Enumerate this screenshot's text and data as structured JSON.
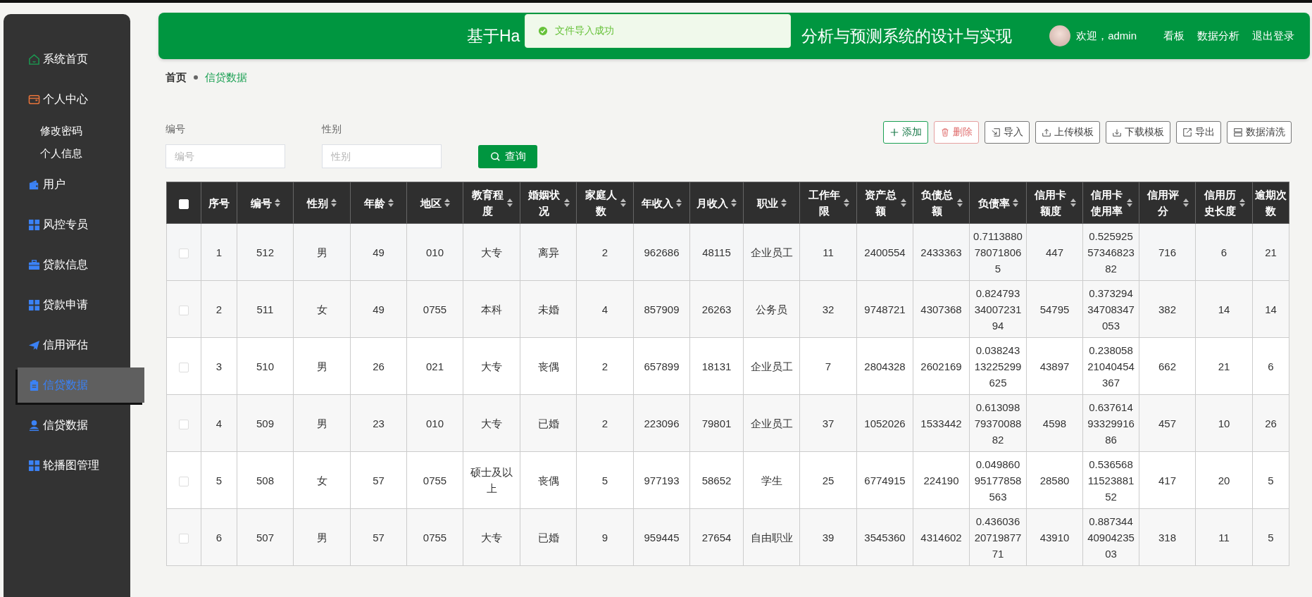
{
  "sidebar": {
    "items": [
      {
        "label": "系统首页",
        "selected": false
      },
      {
        "label": "个人中心",
        "selected": false,
        "children": [
          {
            "label": "修改密码",
            "selected": false
          },
          {
            "label": "个人信息",
            "selected": false
          }
        ]
      },
      {
        "label": "用户",
        "selected": false
      },
      {
        "label": "风控专员",
        "selected": false
      },
      {
        "label": "贷款信息",
        "selected": false
      },
      {
        "label": "贷款申请",
        "selected": false
      },
      {
        "label": "信用评估",
        "selected": false
      },
      {
        "label": "信贷数据",
        "selected": true
      },
      {
        "label": "信贷数据",
        "selected": false
      },
      {
        "label": "轮播图管理",
        "selected": false
      }
    ]
  },
  "header": {
    "title_start": "基于Ha",
    "title_end": "分析与预测系统的设计与实现",
    "welcome": "欢迎，admin",
    "links": [
      "看板",
      "数据分析",
      "退出登录"
    ]
  },
  "toast": {
    "message": "文件导入成功"
  },
  "breadcrumb": [
    "首页",
    "信贷数据"
  ],
  "search": {
    "fields": [
      {
        "label": "编号",
        "placeholder": "编号"
      },
      {
        "label": "性别",
        "placeholder": "性别"
      }
    ],
    "button": "查询"
  },
  "toolbar": [
    {
      "label": "添加",
      "kind": "add"
    },
    {
      "label": "删除",
      "kind": "delete"
    },
    {
      "label": "导入",
      "kind": "default"
    },
    {
      "label": "上传模板",
      "kind": "default"
    },
    {
      "label": "下载模板",
      "kind": "default"
    },
    {
      "label": "导出",
      "kind": "default"
    },
    {
      "label": "数据清洗",
      "kind": "default"
    }
  ],
  "table": {
    "select_all": false,
    "columns": [
      {
        "label": "序号",
        "sortable": false
      },
      {
        "label": "编号",
        "sortable": true
      },
      {
        "label": "性别",
        "sortable": true
      },
      {
        "label": "年龄",
        "sortable": true
      },
      {
        "label": "地区",
        "sortable": true
      },
      {
        "label": "教育程度",
        "sortable": true
      },
      {
        "label": "婚姻状况",
        "sortable": true
      },
      {
        "label": "家庭人数",
        "sortable": true
      },
      {
        "label": "年收入",
        "sortable": true
      },
      {
        "label": "月收入",
        "sortable": true
      },
      {
        "label": "职业",
        "sortable": true
      },
      {
        "label": "工作年限",
        "sortable": true
      },
      {
        "label": "资产总额",
        "sortable": true
      },
      {
        "label": "负债总额",
        "sortable": true
      },
      {
        "label": "负债率",
        "sortable": true
      },
      {
        "label": "信用卡额度",
        "sortable": true
      },
      {
        "label": "信用卡使用率",
        "sortable": true
      },
      {
        "label": "信用评分",
        "sortable": true
      },
      {
        "label": "信用历史长度",
        "sortable": true
      },
      {
        "label": "逾期次数",
        "sortable": false
      }
    ],
    "rows": [
      {
        "checked": false,
        "cells": [
          "1",
          "512",
          "男",
          "49",
          "010",
          "大专",
          "离异",
          "2",
          "962686",
          "48115",
          "企业员工",
          "11",
          "2400554",
          "2433363",
          "0.7113880780718065",
          "447",
          "0.5259255734682382",
          "716",
          "6",
          "21"
        ]
      },
      {
        "checked": false,
        "cells": [
          "2",
          "511",
          "女",
          "49",
          "0755",
          "本科",
          "未婚",
          "4",
          "857909",
          "26263",
          "公务员",
          "32",
          "9748721",
          "4307368",
          "0.8247933400723194",
          "54795",
          "0.37329434708347053",
          "382",
          "14",
          "14"
        ]
      },
      {
        "checked": false,
        "cells": [
          "3",
          "510",
          "男",
          "26",
          "021",
          "大专",
          "丧偶",
          "2",
          "657899",
          "18131",
          "企业员工",
          "7",
          "2804328",
          "2602169",
          "0.03824313225299625",
          "43897",
          "0.23805821040454367",
          "662",
          "21",
          "6"
        ]
      },
      {
        "checked": false,
        "cells": [
          "4",
          "509",
          "男",
          "23",
          "010",
          "大专",
          "已婚",
          "2",
          "223096",
          "79801",
          "企业员工",
          "37",
          "1052026",
          "1533442",
          "0.6130987937008882",
          "4598",
          "0.6376149332991686",
          "457",
          "10",
          "26"
        ]
      },
      {
        "checked": false,
        "cells": [
          "5",
          "508",
          "女",
          "57",
          "0755",
          "硕士及以上",
          "丧偶",
          "5",
          "977193",
          "58652",
          "学生",
          "25",
          "6774915",
          "224190",
          "0.04986095177858563",
          "28580",
          "0.5365681152388152",
          "417",
          "20",
          "5"
        ]
      },
      {
        "checked": false,
        "cells": [
          "6",
          "507",
          "男",
          "57",
          "0755",
          "大专",
          "已婚",
          "9",
          "959445",
          "27654",
          "自由职业",
          "39",
          "3545360",
          "4314602",
          "0.4360362071987771",
          "43910",
          "0.8873444090423503",
          "318",
          "11",
          "5"
        ]
      }
    ]
  }
}
